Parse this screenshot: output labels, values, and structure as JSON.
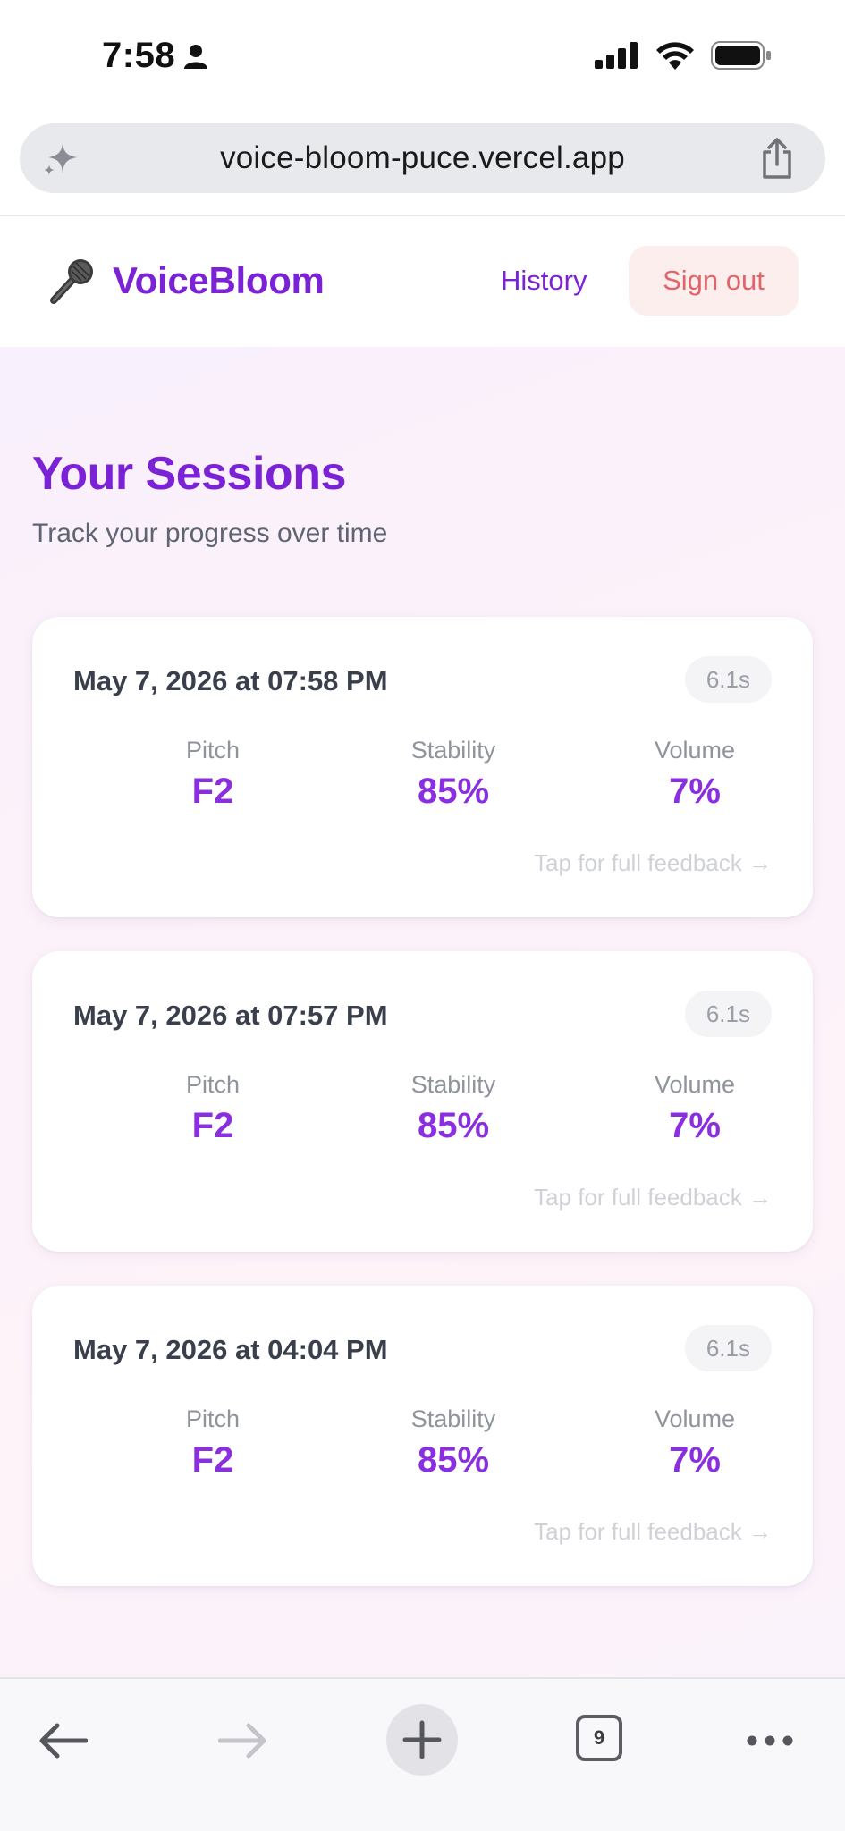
{
  "status_bar": {
    "time": "7:58"
  },
  "browser": {
    "url": "voice-bloom-puce.vercel.app",
    "tab_count": "9"
  },
  "header": {
    "brand": "VoiceBloom",
    "brand_icon": "microphone-icon",
    "history_label": "History",
    "signout_label": "Sign out"
  },
  "page": {
    "title": "Your Sessions",
    "subtitle": "Track your progress over time"
  },
  "sessions": [
    {
      "date": "May 7, 2026 at 07:58 PM",
      "duration": "6.1s",
      "metrics": [
        {
          "label": "Pitch",
          "value": "F2"
        },
        {
          "label": "Stability",
          "value": "85%"
        },
        {
          "label": "Volume",
          "value": "7%"
        }
      ],
      "cta": "Tap for full feedback →"
    },
    {
      "date": "May 7, 2026 at 07:57 PM",
      "duration": "6.1s",
      "metrics": [
        {
          "label": "Pitch",
          "value": "F2"
        },
        {
          "label": "Stability",
          "value": "85%"
        },
        {
          "label": "Volume",
          "value": "7%"
        }
      ],
      "cta": "Tap for full feedback →"
    },
    {
      "date": "May 7, 2026 at 04:04 PM",
      "duration": "6.1s",
      "metrics": [
        {
          "label": "Pitch",
          "value": "F2"
        },
        {
          "label": "Stability",
          "value": "85%"
        },
        {
          "label": "Volume",
          "value": "7%"
        }
      ],
      "cta": "Tap for full feedback →"
    }
  ],
  "colors": {
    "brand_purple": "#7b22d6",
    "metric_purple": "#8a2fe0",
    "signout_text": "#e0656a",
    "signout_bg": "#fdeeee"
  }
}
